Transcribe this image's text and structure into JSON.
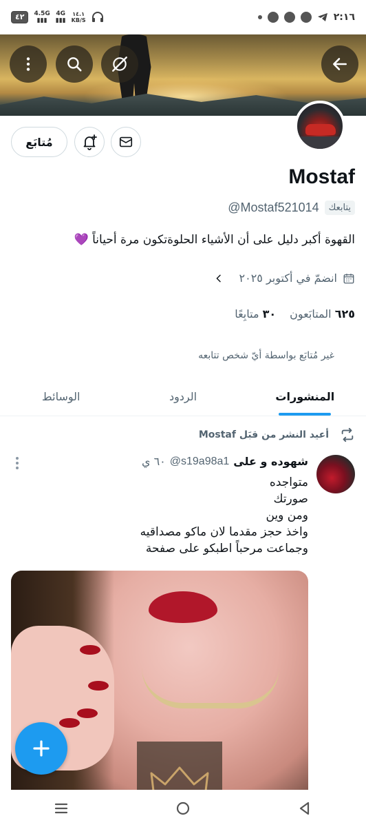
{
  "statusbar": {
    "battery": "٤٢",
    "net1": "4.5G",
    "net2": "4G",
    "speed_value": "١٤.١",
    "speed_unit": "KB/S",
    "time": "٢:١٦"
  },
  "icons": {
    "back": "arrow-left-icon",
    "grok": "grok-icon",
    "search": "search-icon",
    "more": "more-vertical-icon",
    "mail": "mail-icon",
    "bell": "bell-plus-icon",
    "calendar": "calendar-icon",
    "chevron": "chevron-left-icon",
    "repost": "repost-icon",
    "compose": "plus-icon"
  },
  "profile": {
    "follow_label": "مُتابَع",
    "name": "Mostaf",
    "handle": "@Mostaf521014",
    "follows_you": "يتابعك",
    "bio": "القهوة أكبر دليل على أن الأشياء الحلوةتكون مرة أحياناً 💜",
    "joined": "انضمّ في أكتوبر ٢٠٢٥",
    "following_count": "٣٠",
    "following_label": "متابِعًا",
    "followers_count": "٦٢٥",
    "followers_label": "المتابَعون",
    "not_followed_note": "غير مُتابَع بواسطة أيّ شخص تتابعه"
  },
  "tabs": [
    {
      "label": "المنشورات",
      "active": true
    },
    {
      "label": "الردود",
      "active": false
    },
    {
      "label": "الوسائط",
      "active": false
    }
  ],
  "timeline": {
    "repost_text": "أعيد النشر من قبَل Mostaf",
    "tweet": {
      "author_name": "شهوده و على",
      "author_handle": "@s19a98a1",
      "time": "٦٠ ي",
      "lines": [
        "متواجده",
        "صورتك",
        "ومن وين",
        "واخذ حجز مقدما لان ماكو مصداقيه",
        "وجماعت مرحباً اطبكو على صفحة"
      ]
    }
  },
  "colors": {
    "accent": "#1d9bf0",
    "text": "#0f1419",
    "secondary": "#536471"
  }
}
